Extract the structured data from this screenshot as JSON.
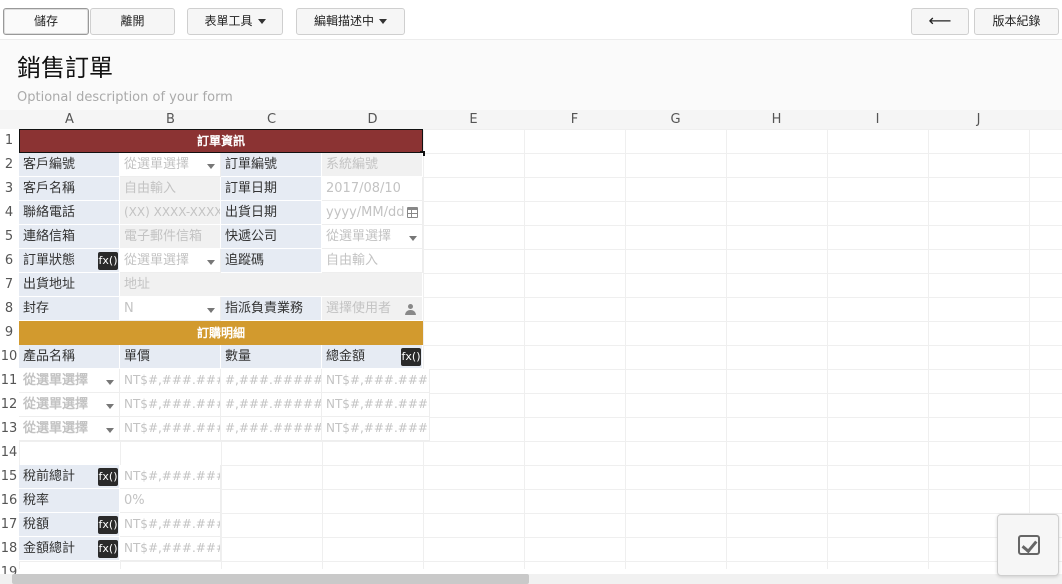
{
  "toolbar": {
    "save": "儲存",
    "leave": "離開",
    "form_tools": "表單工具",
    "editing_desc": "編輯描述中",
    "back": "⟵",
    "version_history": "版本紀錄"
  },
  "form": {
    "title": "銷售訂單",
    "description_placeholder": "Optional description of your form"
  },
  "columns": [
    "A",
    "B",
    "C",
    "D",
    "E",
    "F",
    "G",
    "H",
    "I",
    "J"
  ],
  "rows": [
    "1",
    "2",
    "3",
    "4",
    "5",
    "6",
    "7",
    "8",
    "9",
    "10",
    "11",
    "12",
    "13",
    "14",
    "15",
    "16",
    "17",
    "18",
    "19"
  ],
  "sections": {
    "order_info": "訂單資訊",
    "order_details": "訂購明細"
  },
  "order_fields": {
    "customer_id_label": "客戶編號",
    "customer_id_value": "從選單選擇",
    "order_no_label": "訂單編號",
    "order_no_value": "系統編號",
    "customer_name_label": "客戶名稱",
    "customer_name_value": "自由輸入",
    "order_date_label": "訂單日期",
    "order_date_value": "2017/08/10",
    "phone_label": "聯絡電話",
    "phone_value": "(XX) XXXX-XXXX",
    "ship_date_label": "出貨日期",
    "ship_date_value": "yyyy/MM/dd",
    "email_label": "連絡信箱",
    "email_value": "電子郵件信箱",
    "courier_label": "快遞公司",
    "courier_value": "從選單選擇",
    "status_label": "訂單狀態",
    "status_value": "從選單選擇",
    "tracking_label": "追蹤碼",
    "tracking_value": "自由輸入",
    "address_label": "出貨地址",
    "address_value": "地址",
    "archive_label": "封存",
    "archive_value": "N",
    "assignee_label": "指派負責業務",
    "assignee_value": "選擇使用者",
    "fx_label": "fx()"
  },
  "detail_header": {
    "product": "產品名稱",
    "price": "單價",
    "qty": "數量",
    "total": "總金額"
  },
  "detail_rows": [
    {
      "product": "從選單選擇",
      "price": "NT$#,###.####",
      "qty": "#,###.#####",
      "total": "NT$#,###.#####"
    },
    {
      "product": "從選單選擇",
      "price": "NT$#,###.####",
      "qty": "#,###.#####",
      "total": "NT$#,###.#####"
    },
    {
      "product": "從選單選擇",
      "price": "NT$#,###.####",
      "qty": "#,###.#####",
      "total": "NT$#,###.#####"
    }
  ],
  "summary": {
    "subtotal_label": "稅前總計",
    "subtotal_value": "NT$#,###.#####",
    "tax_rate_label": "稅率",
    "tax_rate_value": "0%",
    "tax_label": "稅額",
    "tax_value": "NT$#,###.#####",
    "grand_total_label": "金額總計",
    "grand_total_value": "NT$#,###.#####"
  },
  "colors": {
    "order_info_header": "#8b3333",
    "order_details_header": "#d29a2e",
    "label_bg": "#e6ebf3"
  }
}
